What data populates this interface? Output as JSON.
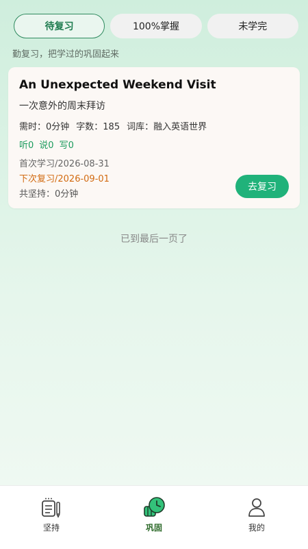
{
  "tabs": [
    {
      "label": "待复习",
      "active": true
    },
    {
      "label": "100%掌握",
      "active": false
    },
    {
      "label": "未学完",
      "active": false
    }
  ],
  "subtitle": "勤复习，把学过的巩固起来",
  "card": {
    "title": "An Unexpected Weekend Visit",
    "title_cn": "一次意外的周末拜访",
    "time": "需时：0分钟",
    "words": "字数：185",
    "lexicon": "词库：融入英语世界",
    "listen": "听0",
    "speak": "说0",
    "write": "写0",
    "first_study": "首次学习/2026-08-31",
    "next_review": "下次复习/2026-09-01",
    "total": "共坚持：0分钟",
    "review_button": "去复习"
  },
  "end_text": "已到最后一页了",
  "nav": [
    {
      "label": "坚持",
      "icon": "notebook-pen-icon"
    },
    {
      "label": "巩固",
      "icon": "review-clock-icon",
      "active": true
    },
    {
      "label": "我的",
      "icon": "person-icon"
    }
  ],
  "colors": {
    "accent": "#20b27a",
    "next_review": "#d26a10",
    "skills": "#1b9b5d"
  }
}
